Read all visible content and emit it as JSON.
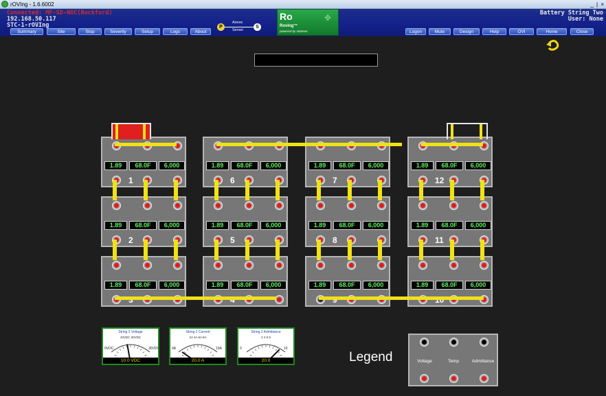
{
  "window": {
    "title": "rOVIng - 1.6.6002",
    "controls": "_ | ×"
  },
  "header": {
    "connection": "Connected: MF-SD-NOC(Rockford)",
    "ip": "192.168.50.117",
    "device": "STC-1-rOVIng",
    "string_name": "Battery String Two",
    "user": "User: None",
    "nav_left": [
      "Summary",
      "Site",
      "Stop",
      "Severity",
      "Setup",
      "Logs",
      "About"
    ],
    "nav_right": [
      "Logon",
      "Mute",
      "Design",
      "Help",
      "OVI",
      "Home",
      "Close"
    ],
    "axess": {
      "p": "P",
      "s": "S",
      "top": "Axess",
      "bottom": "Server"
    },
    "roving": {
      "big": "Ro",
      "mid": "Roving™",
      "small": "powered by statmon"
    }
  },
  "cells": [
    {
      "id": "1",
      "voltage": "1.89",
      "temp": "68.0F",
      "admittance": "6,000"
    },
    {
      "id": "2",
      "voltage": "1.89",
      "temp": "68.0F",
      "admittance": "6,000"
    },
    {
      "id": "3",
      "voltage": "1.89",
      "temp": "68.0F",
      "admittance": "6,000"
    },
    {
      "id": "6",
      "voltage": "1.89",
      "temp": "68.0F",
      "admittance": "6,000"
    },
    {
      "id": "5",
      "voltage": "1.89",
      "temp": "68.0F",
      "admittance": "6,000"
    },
    {
      "id": "4",
      "voltage": "1.89",
      "temp": "68.0F",
      "admittance": "6,000"
    },
    {
      "id": "7",
      "voltage": "1.89",
      "temp": "68.0F",
      "admittance": "6,000"
    },
    {
      "id": "8",
      "voltage": "1.89",
      "temp": "68.0F",
      "admittance": "6,000"
    },
    {
      "id": "9",
      "voltage": "1.89",
      "temp": "68.0F",
      "admittance": "6,000"
    },
    {
      "id": "12",
      "voltage": "1.89",
      "temp": "68.0F",
      "admittance": "6,000"
    },
    {
      "id": "11",
      "voltage": "1.89",
      "temp": "68.0F",
      "admittance": "6,000"
    },
    {
      "id": "10",
      "voltage": "1.89",
      "temp": "68.0F",
      "admittance": "6,000"
    }
  ],
  "meters": [
    {
      "title": "String 2 Voltage",
      "subtitle": "10VDC 20VDC",
      "left": "0VDC",
      "right": "30VDC",
      "readout": "10.0 VDC"
    },
    {
      "title": "String 2 Current",
      "subtitle": "2A 4A 6A 8A",
      "left": "0A",
      "right": "10A",
      "readout": "20.0 A"
    },
    {
      "title": "String 2 Admittance",
      "subtitle": "2 4 6 8",
      "left": "0",
      "right": "10",
      "readout": "20.0"
    }
  ],
  "legend": {
    "title": "Legend",
    "labels": [
      "Voltage",
      "Temp",
      "Admittance"
    ]
  },
  "colors": {
    "green_text": "#5fef5f",
    "strap": "#f1e117",
    "alarm_red": "#e61a1a"
  }
}
